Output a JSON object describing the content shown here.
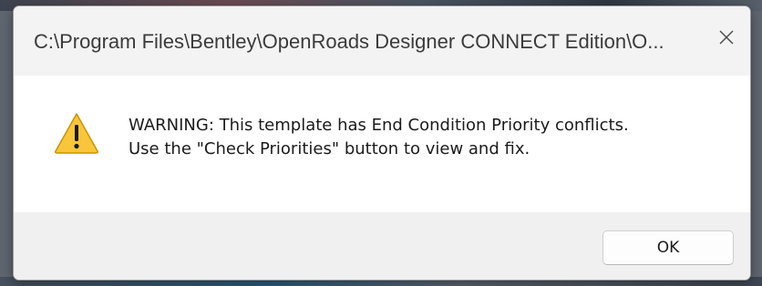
{
  "window": {
    "title": "C:\\Program Files\\Bentley\\OpenRoads Designer CONNECT Edition\\O...",
    "close_icon": "close-icon"
  },
  "message": {
    "icon": "warning-icon",
    "line1": "WARNING: This template has End Condition Priority conflicts.",
    "line2": "Use the \"Check Priorities\" button to view and fix."
  },
  "buttons": {
    "ok_label": "OK"
  },
  "colors": {
    "warning_fill": "#f9c53b",
    "warning_outline": "#c99400"
  }
}
